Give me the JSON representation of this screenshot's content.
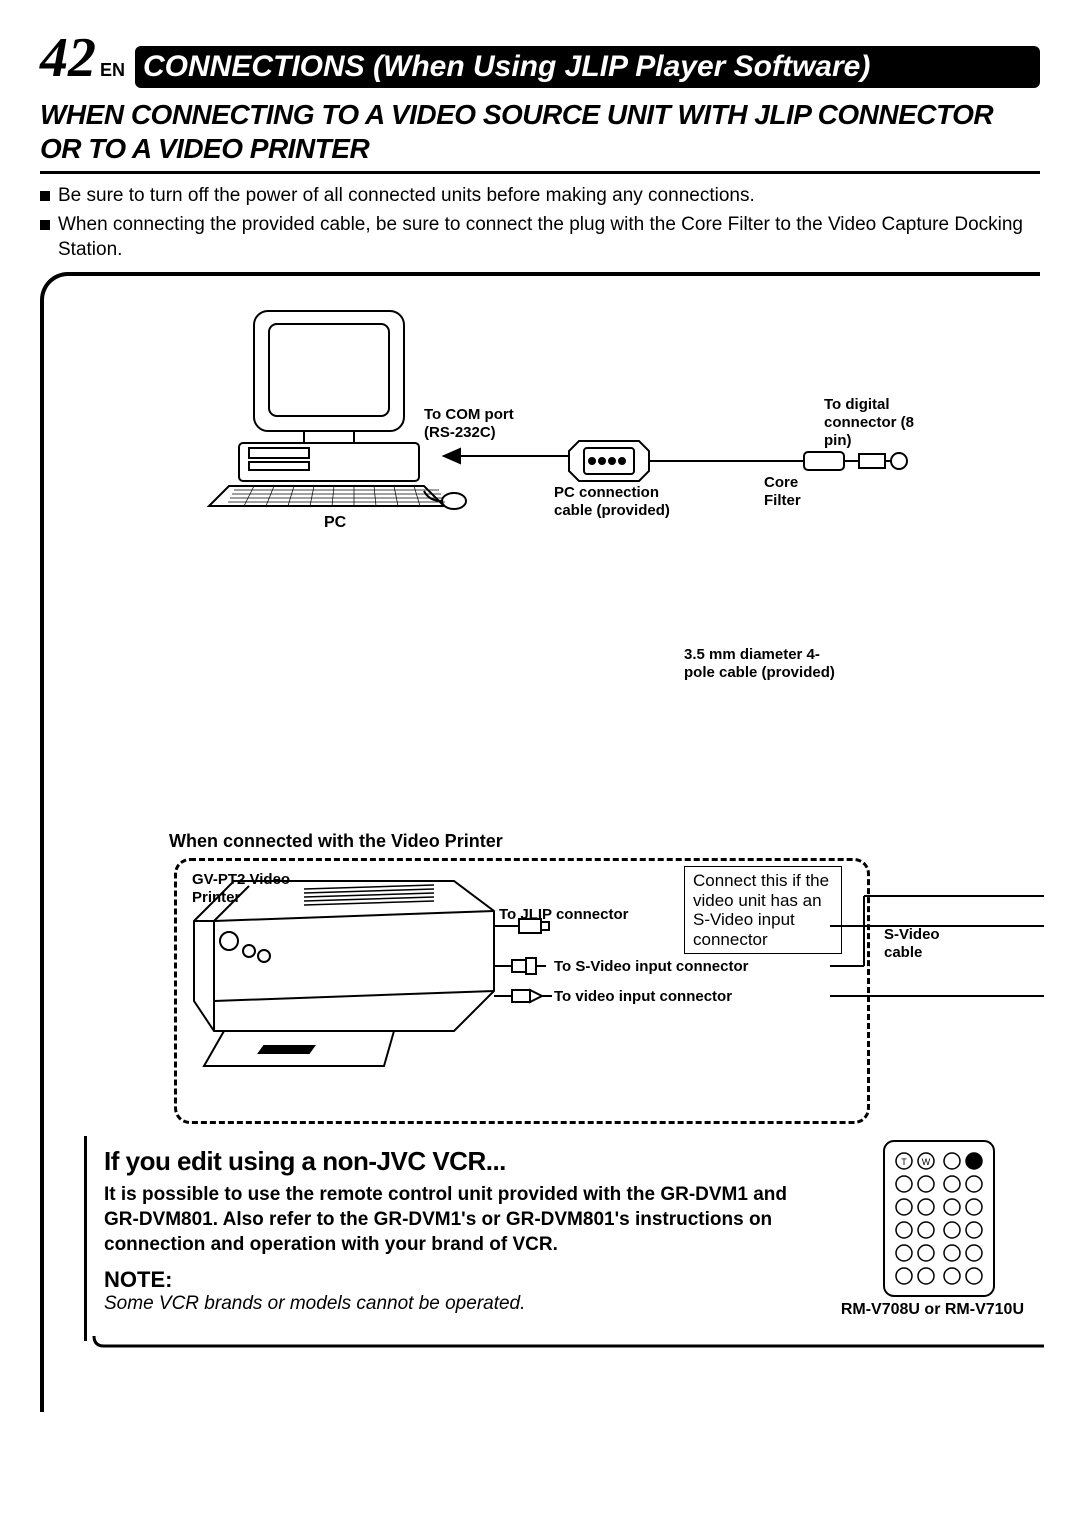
{
  "page_number": "42",
  "lang": "EN",
  "chapter_title": "CONNECTIONS (When Using JLIP Player Software)",
  "section_heading": "When Connecting to a Video Source Unit with JLIP Connector or to a Video Printer",
  "bullets": [
    "Be sure to turn off the power of all connected units before making any connections.",
    "When connecting the provided cable, be sure to connect the plug with the Core Filter to the Video Capture Docking Station."
  ],
  "diagram": {
    "pc_label": "PC",
    "to_com_port": "To COM port (RS-232C)",
    "pc_cable": "PC connection cable (provided)",
    "core_filter": "Core Filter",
    "to_digital": "To digital connector (8 pin)",
    "pole_cable": "3.5 mm diameter 4-pole cable (provided)",
    "printer_section_heading": "When connected with the Video Printer",
    "printer_label": "GV-PT2 Video Printer",
    "to_jlip": "To JLIP connector",
    "to_svideo_in": "To S-Video input connector",
    "to_video_in": "To video input connector",
    "svideo_note": "Connect this if the video unit has an S-Video input connector",
    "svideo_cable": "S-Video cable"
  },
  "bottom": {
    "heading": "If you edit using a non-JVC VCR...",
    "body": "It is possible to use the remote control unit provided with  the GR-DVM1 and GR-DVM801. Also refer to the GR-DVM1's or GR-DVM801's instructions on connection and operation with your brand of VCR.",
    "note_label": "NOTE:",
    "note_text": "Some VCR brands or models cannot be operated.",
    "remote_label": "RM-V708U or RM-V710U"
  }
}
